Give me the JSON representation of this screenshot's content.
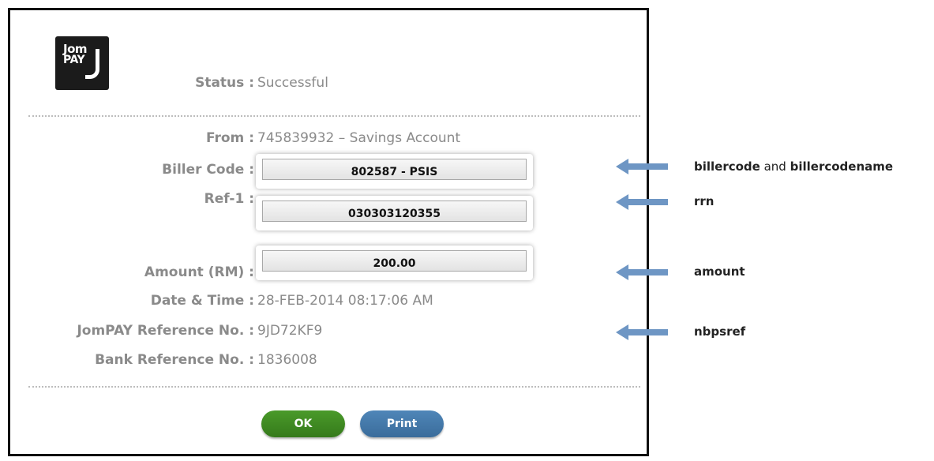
{
  "logo": {
    "line1": "Jom",
    "line2": "PAY"
  },
  "status": {
    "label": "Status :",
    "value": "Successful"
  },
  "fields": {
    "from": {
      "label": "From :",
      "value": "745839932 – Savings Account"
    },
    "biller_code": {
      "label": "Biller Code :",
      "value": "802587 - PSIS"
    },
    "ref1": {
      "label": "Ref-1 :",
      "value": "030303120355"
    },
    "amount": {
      "label": "Amount (RM) :",
      "value": "200.00"
    },
    "datetime": {
      "label": "Date & Time :",
      "value": "28-FEB-2014  08:17:06 AM"
    },
    "jompay_ref": {
      "label": "JomPAY Reference No. :",
      "value": "9JD72KF9"
    },
    "bank_ref": {
      "label": "Bank Reference No. :",
      "value": "1836008"
    }
  },
  "buttons": {
    "ok": "OK",
    "print": "Print"
  },
  "annotations": {
    "biller": {
      "part1": "billercode",
      "part2": " and ",
      "part3": "billercodename"
    },
    "rrn": "rrn",
    "amount": "amount",
    "nbpsref": "nbpsref"
  },
  "colors": {
    "arrow": "#6e96c4",
    "ok": "#3f8a22",
    "print": "#467aab"
  }
}
